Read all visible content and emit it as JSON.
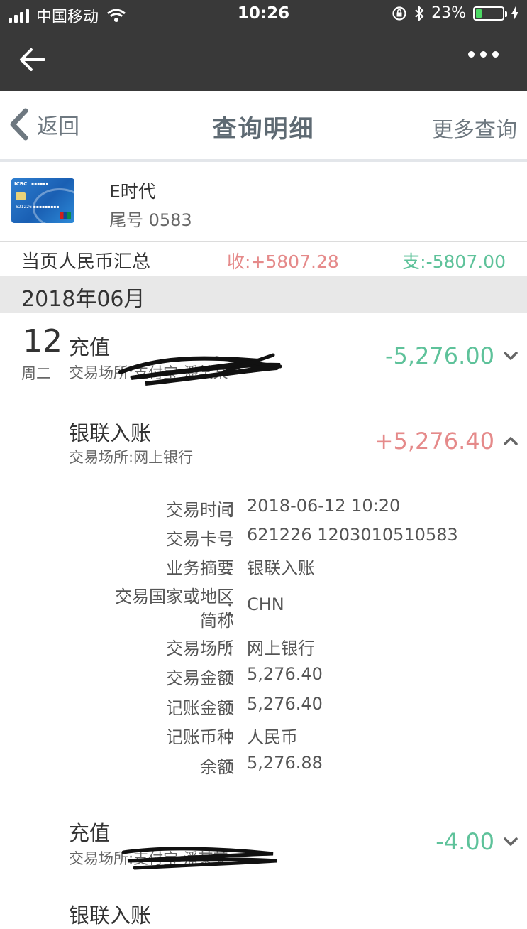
{
  "status_bar": {
    "carrier": "中国移动",
    "time": "10:26",
    "battery": "23%",
    "battery_level": 0.23
  },
  "header": {
    "back_label": "返回",
    "title": "查询明细",
    "more_label": "更多查询"
  },
  "card": {
    "name": "E时代",
    "tail": "尾号 0583"
  },
  "summary": {
    "label": "当页人民币汇总",
    "income": "收:+5807.28",
    "expense": "支:-5807.00"
  },
  "month": "2018年06月",
  "day": {
    "date": "12",
    "weekday": "周二"
  },
  "transactions": [
    {
      "title": "充值",
      "place": "交易场所:支付宝-潘某某",
      "amount": "-5,276.00",
      "expanded": false
    },
    {
      "title": "银联入账",
      "place": "交易场所:网上银行",
      "amount": "+5,276.40",
      "expanded": true
    },
    {
      "title": "充值",
      "place": "交易场所:支付宝-潘某某",
      "amount": "-4.00",
      "expanded": false
    },
    {
      "title": "银联入账",
      "place": "",
      "amount": "",
      "expanded": false
    }
  ],
  "details": [
    {
      "label": "交易时间",
      "value": "2018-06-12 10:20"
    },
    {
      "label": "交易卡号",
      "value": "621226 1203010510583"
    },
    {
      "label": "业务摘要",
      "value": "银联入账"
    },
    {
      "label_line1": "交易国家或地区",
      "label_line2": "简称",
      "value": "CHN"
    },
    {
      "label": "交易场所",
      "value": "网上银行"
    },
    {
      "label": "交易金额",
      "value": "5,276.40"
    },
    {
      "label": "记账金额",
      "value": "5,276.40"
    },
    {
      "label": "记账币种",
      "value": "人民币"
    },
    {
      "label": "余额",
      "value": "5,276.88"
    }
  ],
  "colon": "："
}
